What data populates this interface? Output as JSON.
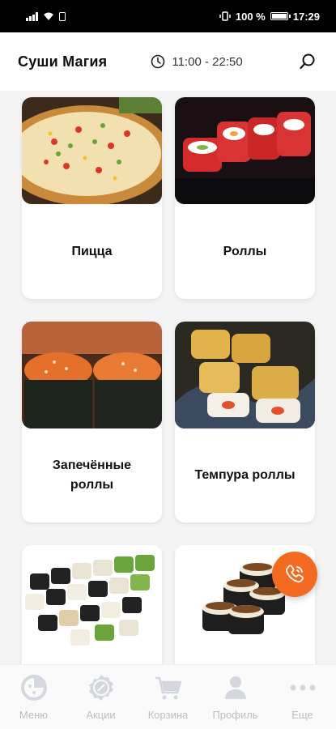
{
  "status_bar": {
    "battery": "100 %",
    "time": "17:29"
  },
  "header": {
    "title": "Суши Магия",
    "hours": "11:00 - 22:50",
    "icons": [
      "clock-icon",
      "search-icon"
    ]
  },
  "categories": [
    {
      "label": "Пицца",
      "image": "pizza-image"
    },
    {
      "label": "Роллы",
      "image": "rolls-image"
    },
    {
      "label": "Запечённые роллы",
      "image": "baked-rolls-image"
    },
    {
      "label": "Темпура роллы",
      "image": "tempura-rolls-image"
    },
    {
      "label": "",
      "image": "sushi-sets-image"
    },
    {
      "label": "",
      "image": "eel-rolls-image"
    }
  ],
  "fab": {
    "icon": "phone-call-icon",
    "color": "#f26b21"
  },
  "bottom_nav": {
    "items": [
      {
        "label": "Меню",
        "icon": "menu-pizza-icon"
      },
      {
        "label": "Акции",
        "icon": "promo-badge-icon"
      },
      {
        "label": "Корзина",
        "icon": "cart-icon"
      },
      {
        "label": "Профиль",
        "icon": "profile-icon"
      },
      {
        "label": "Еще",
        "icon": "more-dots-icon"
      }
    ]
  }
}
